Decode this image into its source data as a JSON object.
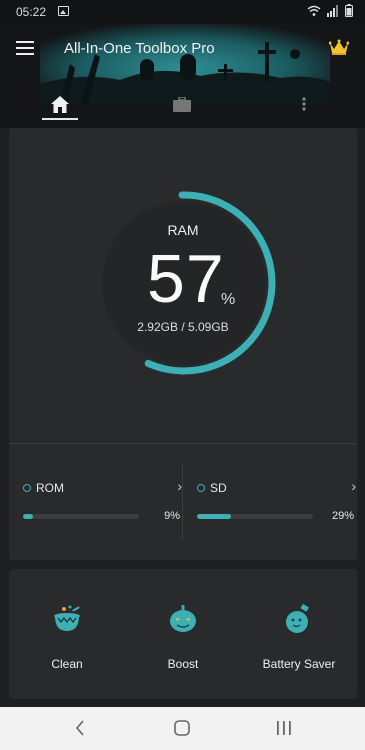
{
  "status_bar": {
    "time": "05:22"
  },
  "app": {
    "title": "All-In-One Toolbox Pro",
    "accent": "#3cb0b5"
  },
  "tabs": [
    {
      "icon": "home-icon",
      "active": true
    },
    {
      "icon": "briefcase-icon"
    },
    {
      "icon": "more-vert-icon"
    }
  ],
  "ram": {
    "label": "RAM",
    "percent": "57",
    "unit": "%",
    "usage": "2.92GB / 5.09GB",
    "fraction": 0.57
  },
  "storage": [
    {
      "label": "ROM",
      "percent_text": "9%",
      "fraction": 0.09
    },
    {
      "label": "SD",
      "percent_text": "29%",
      "fraction": 0.29
    }
  ],
  "tools": [
    {
      "label": "Clean",
      "icon": "cauldron-icon"
    },
    {
      "label": "Boost",
      "icon": "pumpkin-icon"
    },
    {
      "label": "Battery Saver",
      "icon": "potion-icon"
    }
  ]
}
